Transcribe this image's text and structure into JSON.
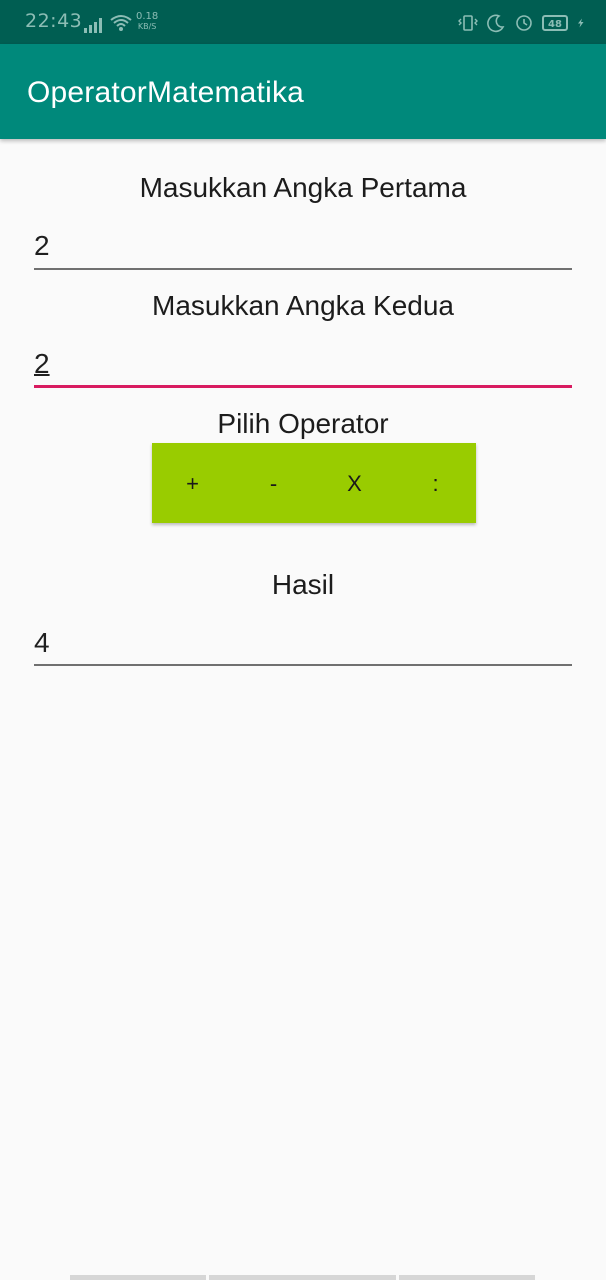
{
  "status_bar": {
    "time": "22:43",
    "speed_value": "0.18",
    "speed_unit": "KB/S",
    "battery": "48",
    "icons": [
      "signal-icon",
      "wifi-icon",
      "vibrate-icon",
      "moon-icon",
      "alarm-icon",
      "battery-icon",
      "charging-icon"
    ]
  },
  "app_bar": {
    "title": "OperatorMatematika",
    "color": "#00897b"
  },
  "form": {
    "first_label": "Masukkan Angka Pertama",
    "first_value": "2",
    "second_label": "Masukkan Angka Kedua",
    "second_value": "2",
    "operator_label": "Pilih Operator",
    "operators": [
      "+",
      "-",
      "X",
      ":"
    ],
    "result_label": "Hasil",
    "result_value": "4"
  },
  "colors": {
    "accent": "#d81b60",
    "operator_bar": "#99cc00",
    "status_bar": "#005e52"
  }
}
